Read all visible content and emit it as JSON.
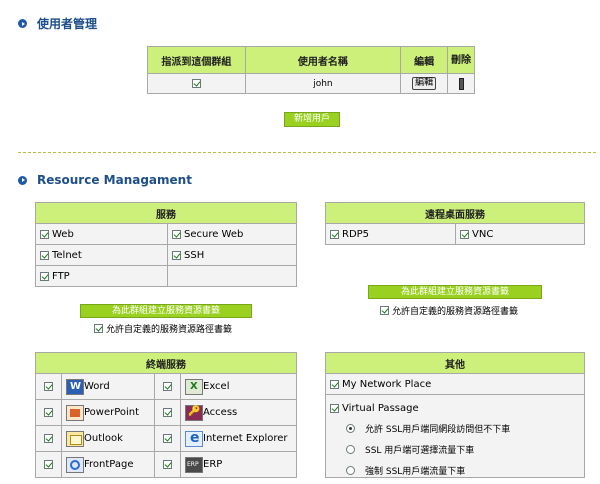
{
  "user_section": {
    "title": "使用者管理",
    "headers": {
      "assign": "指派到這個群組",
      "username": "使用者名稱",
      "edit": "編輯",
      "delete": "刪除"
    },
    "rows": [
      {
        "assigned": true,
        "username": "john",
        "edit_label": "編輯"
      }
    ],
    "add_user_label": "新增用戶"
  },
  "resource_section": {
    "title": "Resource Managament",
    "services": {
      "header": "服務",
      "items": [
        {
          "label": "Web",
          "checked": true
        },
        {
          "label": "Secure Web",
          "checked": true
        },
        {
          "label": "Telnet",
          "checked": true
        },
        {
          "label": "SSH",
          "checked": true
        },
        {
          "label": "FTP",
          "checked": true
        }
      ],
      "create_button": "為此群組建立服務資源書籤",
      "allow_label": "允許自定義的服務資源路徑書籤",
      "allow_checked": true
    },
    "remote": {
      "header": "遠程桌面服務",
      "items": [
        {
          "label": "RDP5",
          "checked": true
        },
        {
          "label": "VNC",
          "checked": true
        }
      ],
      "create_button": "為此群組建立服務資源書籤",
      "allow_label": "允許自定義的服務資源路徑書籤",
      "allow_checked": true
    },
    "terminal": {
      "header": "終端服務",
      "items": [
        {
          "label": "Word",
          "icon": "word-icon",
          "checked": true
        },
        {
          "label": "Excel",
          "icon": "excel-icon",
          "checked": true
        },
        {
          "label": "PowerPoint",
          "icon": "powerpoint-icon",
          "checked": true
        },
        {
          "label": "Access",
          "icon": "access-icon",
          "checked": true
        },
        {
          "label": "Outlook",
          "icon": "outlook-icon",
          "checked": true
        },
        {
          "label": "Internet Explorer",
          "icon": "internet-explorer-icon",
          "checked": true
        },
        {
          "label": "FrontPage",
          "icon": "frontpage-icon",
          "checked": true
        },
        {
          "label": "ERP",
          "icon": "erp-icon",
          "checked": true
        }
      ]
    },
    "other": {
      "header": "其他",
      "my_network_place": {
        "label": "My Network Place",
        "checked": true
      },
      "virtual_passage": {
        "label": "Virtual Passage",
        "checked": true
      },
      "radio_options": [
        {
          "label": "允許 SSL用戶端同網段訪問但不下車",
          "selected": true
        },
        {
          "label": "SSL 用戶端可選擇流量下車",
          "selected": false
        },
        {
          "label": "強制 SSL用戶端流量下車",
          "selected": false
        }
      ]
    }
  },
  "colors": {
    "header_bg": "#ccf07a",
    "button_green": "#9ad020",
    "title_blue": "#1e4f8a",
    "cell_bg": "#f3f3f3"
  }
}
